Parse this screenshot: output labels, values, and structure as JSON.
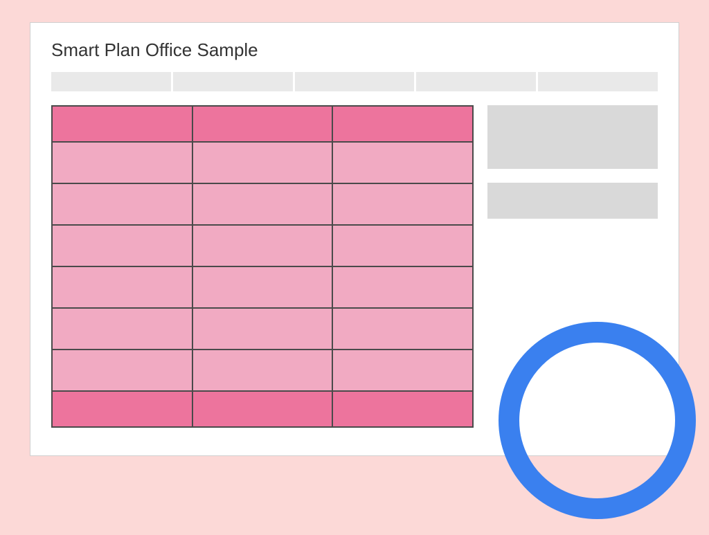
{
  "panel": {
    "title": "Smart Plan Office Sample"
  },
  "nav": {
    "columns": 5
  },
  "grid": {
    "columns": 3,
    "header_row": 1,
    "body_rows": 6,
    "footer_row": 1,
    "colors": {
      "header": "#ed749d",
      "body": "#f1aac2",
      "footer": "#ed749d",
      "border": "#4a4a4a"
    }
  },
  "sidebar": {
    "boxes": 2
  },
  "annotation": {
    "type": "circle",
    "color": "#3a80ef"
  }
}
